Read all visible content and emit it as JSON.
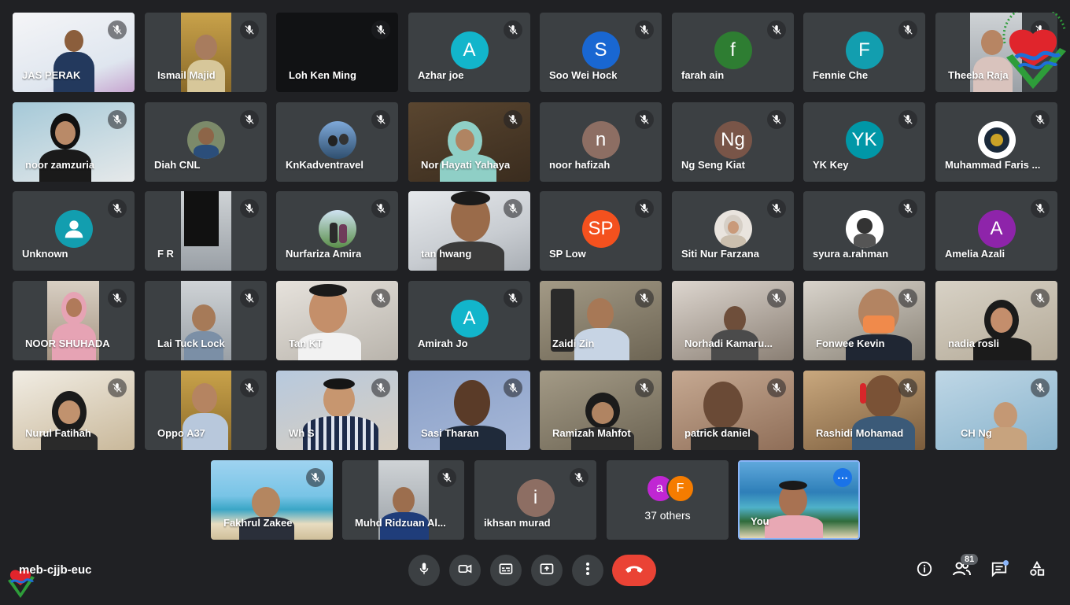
{
  "tiles": [
    {
      "name": "JAS PERAK"
    },
    {
      "name": "Ismail Majid"
    },
    {
      "name": "Loh Ken Ming"
    },
    {
      "name": "Azhar joe",
      "initial": "A",
      "color": "#12b5cb"
    },
    {
      "name": "Soo Wei Hock",
      "initial": "S",
      "color": "#1967d2"
    },
    {
      "name": "farah ain",
      "initial": "f",
      "color": "#2e7d32"
    },
    {
      "name": "Fennie Che",
      "initial": "F",
      "color": "#129eaf"
    },
    {
      "name": "Theeba Raja"
    },
    {
      "name": "noor zamzuria"
    },
    {
      "name": "Diah CNL"
    },
    {
      "name": "KnKadventravel"
    },
    {
      "name": "Nor Hayati Yahaya"
    },
    {
      "name": "noor hafizah",
      "initial": "n",
      "color": "#8d6e63"
    },
    {
      "name": "Ng Seng Kiat",
      "initial": "Ng",
      "color": "#795548"
    },
    {
      "name": "YK Key",
      "initial": "YK",
      "color": "#0097a7"
    },
    {
      "name": "Muhammad Faris ..."
    },
    {
      "name": "Unknown"
    },
    {
      "name": "F R"
    },
    {
      "name": "Nurfariza Amira"
    },
    {
      "name": "tan hwang"
    },
    {
      "name": "SP Low",
      "initial": "SP",
      "color": "#f4511e"
    },
    {
      "name": "Siti Nur Farzana"
    },
    {
      "name": "syura a.rahman"
    },
    {
      "name": "Amelia Azali",
      "initial": "A",
      "color": "#8e24aa"
    },
    {
      "name": "NOOR SHUHADA"
    },
    {
      "name": "Lai Tuck Lock"
    },
    {
      "name": "Tan KT"
    },
    {
      "name": "Amirah Jo",
      "initial": "A",
      "color": "#12b5cb"
    },
    {
      "name": "Zaidi Zin"
    },
    {
      "name": "Norhadi Kamaru..."
    },
    {
      "name": "Fonwee Kevin"
    },
    {
      "name": "nadia rosli"
    },
    {
      "name": "Nurul Fatihah"
    },
    {
      "name": "Oppo A37"
    },
    {
      "name": "Wh S"
    },
    {
      "name": "Sasi Tharan"
    },
    {
      "name": "Ramizah Mahfot"
    },
    {
      "name": "patrick daniel"
    },
    {
      "name": "Rashidi Mohamad"
    },
    {
      "name": "CH Ng"
    },
    {
      "name": "Fakhrul Zakee"
    },
    {
      "name": "Muhd Ridzuan Al..."
    },
    {
      "name": "ikhsan murad",
      "initial": "i",
      "color": "#8d6e63"
    }
  ],
  "others": {
    "label": "37 others",
    "avatars": [
      {
        "initial": "a",
        "color": "#c026d3"
      },
      {
        "initial": "F",
        "color": "#f57c00"
      }
    ]
  },
  "self": {
    "name": "You"
  },
  "bottombar": {
    "meeting_code": "meb-cjjb-euc",
    "participants_count": "81",
    "icons": [
      "mic-icon",
      "camera-icon",
      "captions-icon",
      "present-icon",
      "more-options-icon",
      "end-call-icon",
      "info-icon",
      "people-icon",
      "chat-icon",
      "activities-icon"
    ]
  },
  "colors": {
    "background": "#202124",
    "tile": "#3c4043",
    "end_call": "#ea4335",
    "accent": "#8ab4f8"
  }
}
